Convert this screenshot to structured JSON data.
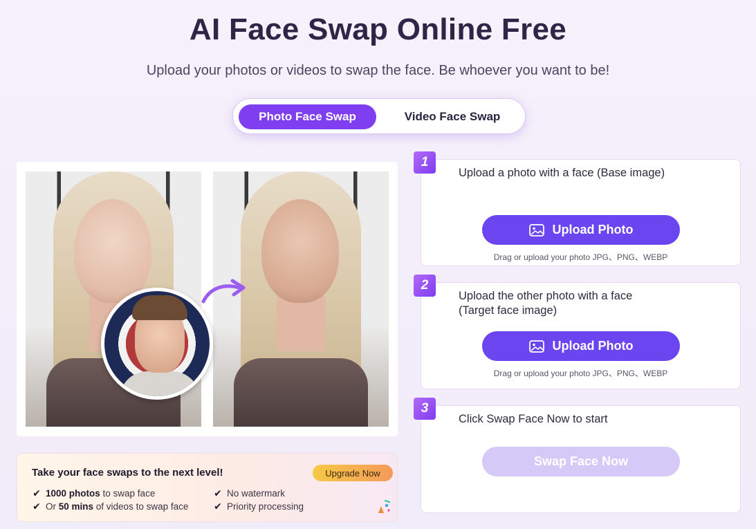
{
  "header": {
    "title": "AI Face Swap Online Free",
    "subtitle": "Upload your photos or videos to swap the face. Be whoever you want to be!"
  },
  "mode_toggle": {
    "options": [
      {
        "label": "Photo Face Swap",
        "active": true
      },
      {
        "label": "Video Face Swap",
        "active": false
      }
    ]
  },
  "promo": {
    "title": "Take your face swaps to the next level!",
    "upgrade_label": "Upgrade Now",
    "features": [
      {
        "bold": "1000 photos",
        "rest": " to swap face",
        "prefix": ""
      },
      {
        "bold": "",
        "rest": "No watermark",
        "prefix": ""
      },
      {
        "bold": "50 mins",
        "rest": " of videos to swap face",
        "prefix": "Or "
      },
      {
        "bold": "",
        "rest": "Priority processing",
        "prefix": ""
      }
    ]
  },
  "steps": [
    {
      "number": "1",
      "text": "Upload a photo with a face (Base image)",
      "button_label": "Upload Photo",
      "hint": "Drag or upload your photo JPG、PNG、WEBP"
    },
    {
      "number": "2",
      "text": "Upload the other photo with a face (Target face image)",
      "button_label": "Upload Photo",
      "hint": "Drag or upload your photo JPG、PNG、WEBP"
    },
    {
      "number": "3",
      "text": "Click Swap Face Now to start",
      "button_label": "Swap Face Now"
    }
  ],
  "colors": {
    "accent": "#7f3ff0",
    "upload_button": "#6b45f0",
    "disabled_button": "#d5c9f8",
    "upgrade_gradient_start": "#f6c945",
    "upgrade_gradient_end": "#f59a5a"
  },
  "icons": {
    "upload": "image-icon",
    "swap": "curved-arrow-icon",
    "check": "check-icon"
  }
}
